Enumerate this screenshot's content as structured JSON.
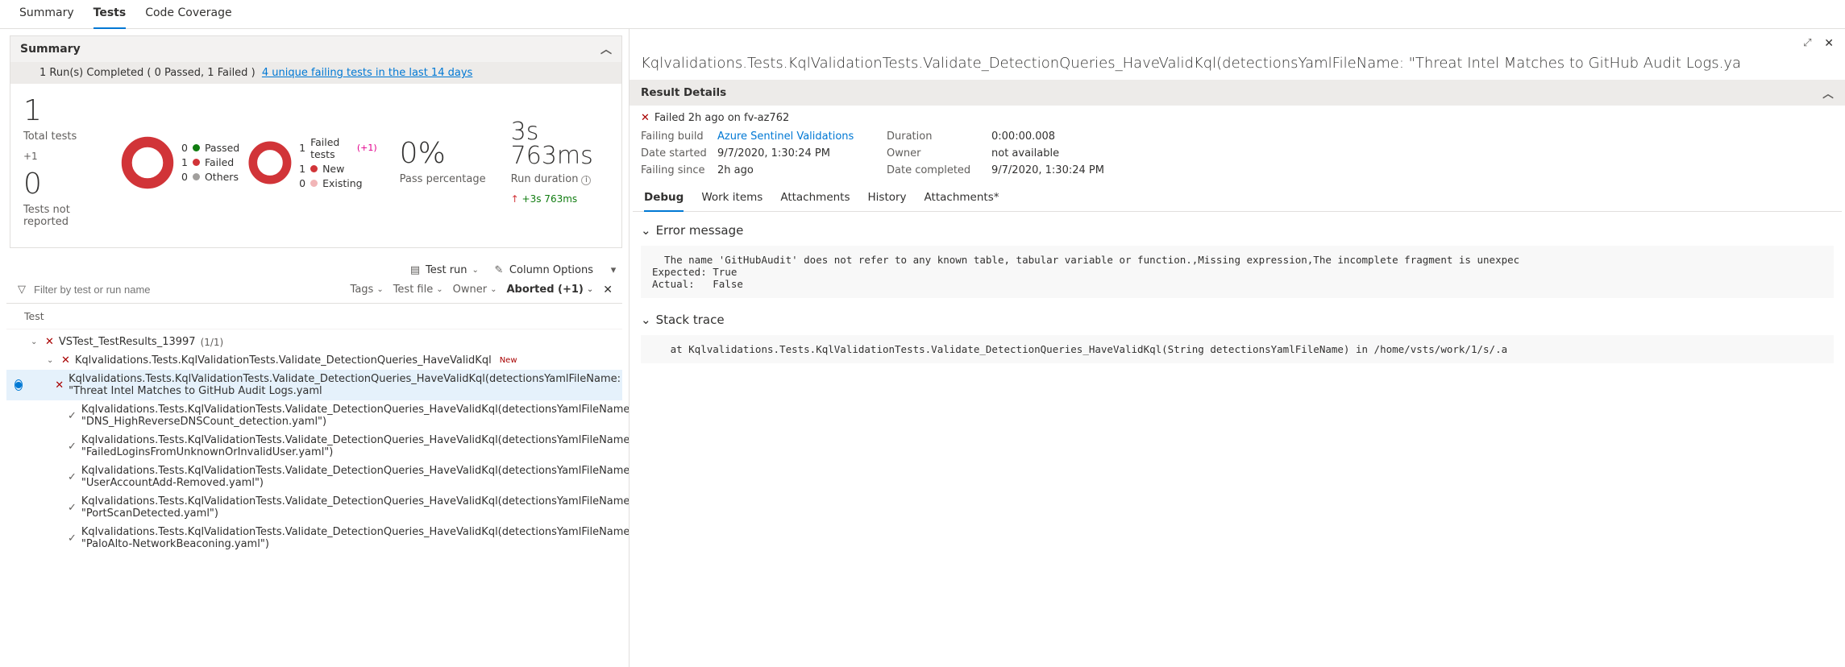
{
  "tabs": {
    "summary": "Summary",
    "tests": "Tests",
    "coverage": "Code Coverage",
    "active": "Tests"
  },
  "summary": {
    "title": "Summary",
    "banner_runs": "1 Run(s) Completed  ( 0 Passed, 1 Failed )",
    "banner_link": "4 unique failing tests in the last 14 days",
    "total_tests_num": "1",
    "total_tests_label": "Total tests",
    "total_tests_delta": "+1",
    "not_reported_num": "0",
    "not_reported_label": "Tests not reported",
    "outcome_legend": [
      {
        "count": "0",
        "color": "d-green",
        "label": "Passed"
      },
      {
        "count": "1",
        "color": "d-red",
        "label": "Failed"
      },
      {
        "count": "0",
        "color": "d-grey",
        "label": "Others"
      }
    ],
    "failure_count": "1",
    "failure_label": "Failed tests",
    "failure_plus": "(+1)",
    "failure_legend": [
      {
        "count": "1",
        "color": "d-ored",
        "label": "New"
      },
      {
        "count": "0",
        "color": "d-pink",
        "label": "Existing"
      }
    ],
    "pass_pct": "0%",
    "pass_label": "Pass percentage",
    "run_dur": "3s 763ms",
    "run_dur_label": "Run duration",
    "run_dur_delta": "+3s 763ms"
  },
  "toolbar": {
    "test_run": "Test run",
    "column_options": "Column Options"
  },
  "filter": {
    "placeholder": "Filter by test or run name",
    "tags": "Tags",
    "test_file": "Test file",
    "owner": "Owner",
    "aborted": "Aborted (+1)"
  },
  "table": {
    "col_test": "Test"
  },
  "tree": {
    "run": {
      "name": "VSTest_TestResults_13997",
      "count": "(1/1)"
    },
    "group": {
      "name": "Kqlvalidations.Tests.KqlValidationTests.Validate_DetectionQueries_HaveValidKql",
      "badge": "New"
    },
    "rows": [
      {
        "status": "fail",
        "text": "Kqlvalidations.Tests.KqlValidationTests.Validate_DetectionQueries_HaveValidKql(detectionsYamlFileName: \"Threat Intel Matches to GitHub Audit Logs.yaml",
        "selected": true
      },
      {
        "status": "pass",
        "text": "Kqlvalidations.Tests.KqlValidationTests.Validate_DetectionQueries_HaveValidKql(detectionsYamlFileName: \"DNS_HighReverseDNSCount_detection.yaml\")"
      },
      {
        "status": "pass",
        "text": "Kqlvalidations.Tests.KqlValidationTests.Validate_DetectionQueries_HaveValidKql(detectionsYamlFileName: \"FailedLoginsFromUnknownOrInvalidUser.yaml\")"
      },
      {
        "status": "pass",
        "text": "Kqlvalidations.Tests.KqlValidationTests.Validate_DetectionQueries_HaveValidKql(detectionsYamlFileName: \"UserAccountAdd-Removed.yaml\")"
      },
      {
        "status": "pass",
        "text": "Kqlvalidations.Tests.KqlValidationTests.Validate_DetectionQueries_HaveValidKql(detectionsYamlFileName: \"PortScanDetected.yaml\")"
      },
      {
        "status": "pass",
        "text": "Kqlvalidations.Tests.KqlValidationTests.Validate_DetectionQueries_HaveValidKql(detectionsYamlFileName: \"PaloAlto-NetworkBeaconing.yaml\")"
      }
    ]
  },
  "detail": {
    "title": "Kqlvalidations.Tests.KqlValidationTests.Validate_DetectionQueries_HaveValidKql(detectionsYamlFileName: \"Threat Intel Matches to GitHub Audit Logs.ya",
    "result_details": "Result Details",
    "failed_line": "Failed 2h ago on fv-az762",
    "kv": {
      "failing_build_k": "Failing build",
      "failing_build_v": "Azure Sentinel Validations",
      "date_started_k": "Date started",
      "date_started_v": "9/7/2020, 1:30:24 PM",
      "failing_since_k": "Failing since",
      "failing_since_v": "2h ago",
      "duration_k": "Duration",
      "duration_v": "0:00:00.008",
      "owner_k": "Owner",
      "owner_v": "not available",
      "date_completed_k": "Date completed",
      "date_completed_v": "9/7/2020, 1:30:24 PM"
    },
    "tabs": {
      "debug": "Debug",
      "work_items": "Work items",
      "attachments": "Attachments",
      "history": "History",
      "attachments2": "Attachments*"
    },
    "error_h": "Error message",
    "error_body": "  The name 'GitHubAudit' does not refer to any known table, tabular variable or function.,Missing expression,The incomplete fragment is unexpec\nExpected: True\nActual:   False",
    "stack_h": "Stack trace",
    "stack_body": "   at Kqlvalidations.Tests.KqlValidationTests.Validate_DetectionQueries_HaveValidKql(String detectionsYamlFileName) in /home/vsts/work/1/s/.a"
  }
}
